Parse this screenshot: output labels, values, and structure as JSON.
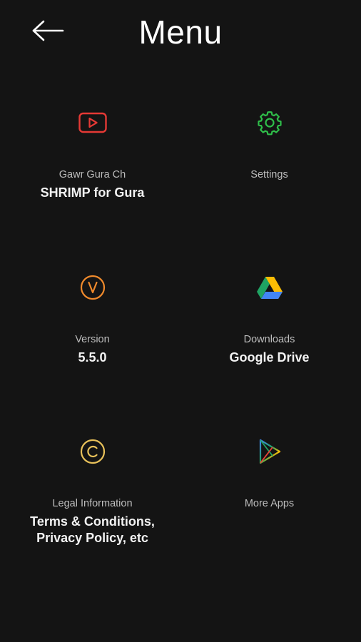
{
  "header": {
    "title": "Menu",
    "back_icon": "arrow-left-icon"
  },
  "menu": [
    {
      "icon": "youtube-icon",
      "icon_color": "#e53935",
      "caption": "Gawr Gura Ch",
      "value": "SHRIMP for Gura"
    },
    {
      "icon": "gear-icon",
      "icon_color": "#2fbf4a",
      "caption": "Settings",
      "value": ""
    },
    {
      "icon": "version-v-icon",
      "icon_color": "#f08a2c",
      "caption": "Version",
      "value": "5.5.0"
    },
    {
      "icon": "google-drive-icon",
      "icon_color": "#1fa463",
      "caption": "Downloads",
      "value": "Google Drive"
    },
    {
      "icon": "copyright-icon",
      "icon_color": "#e8c15a",
      "caption": "Legal Information",
      "value": "Terms & Conditions,\nPrivacy Policy, etc"
    },
    {
      "icon": "google-play-icon",
      "icon_color": "#4285f4",
      "caption": "More Apps",
      "value": ""
    }
  ]
}
